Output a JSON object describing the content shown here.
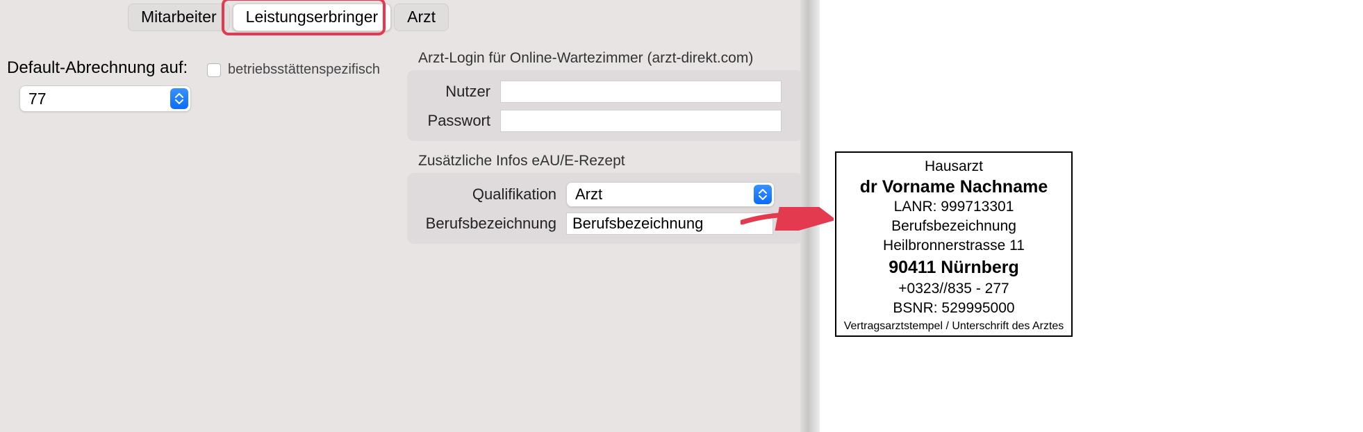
{
  "tabs": {
    "items": [
      {
        "label": "Mitarbeiter",
        "active": false
      },
      {
        "label": "Leistungserbringer",
        "active": true
      },
      {
        "label": "Arzt",
        "active": false
      }
    ]
  },
  "default_billing": {
    "label": "Default-Abrechnung auf:",
    "value": "77",
    "checkbox_label": "betriebsstättenspezifisch",
    "checkbox_checked": false
  },
  "arzt_login": {
    "title": "Arzt-Login für Online-Wartezimmer (arzt-direkt.com)",
    "user_label": "Nutzer",
    "user_value": "",
    "password_label": "Passwort",
    "password_value": ""
  },
  "extra_info": {
    "title": "Zusätzliche Infos eAU/E-Rezept",
    "qualification_label": "Qualifikation",
    "qualification_value": "Arzt",
    "jobtitle_label": "Berufsbezeichnung",
    "jobtitle_value": "Berufsbezeichnung"
  },
  "stamp": {
    "role": "Hausarzt",
    "name": "dr Vorname Nachname",
    "lanr": "LANR: 999713301",
    "jobtitle": "Berufsbezeichnung",
    "street": "Heilbronnerstrasse 11",
    "city": "90411 Nürnberg",
    "phone": "+0323//835 - 277",
    "bsnr": "BSNR: 529995000",
    "footer": "Vertragsarztstempel / Unterschrift des Arztes"
  }
}
